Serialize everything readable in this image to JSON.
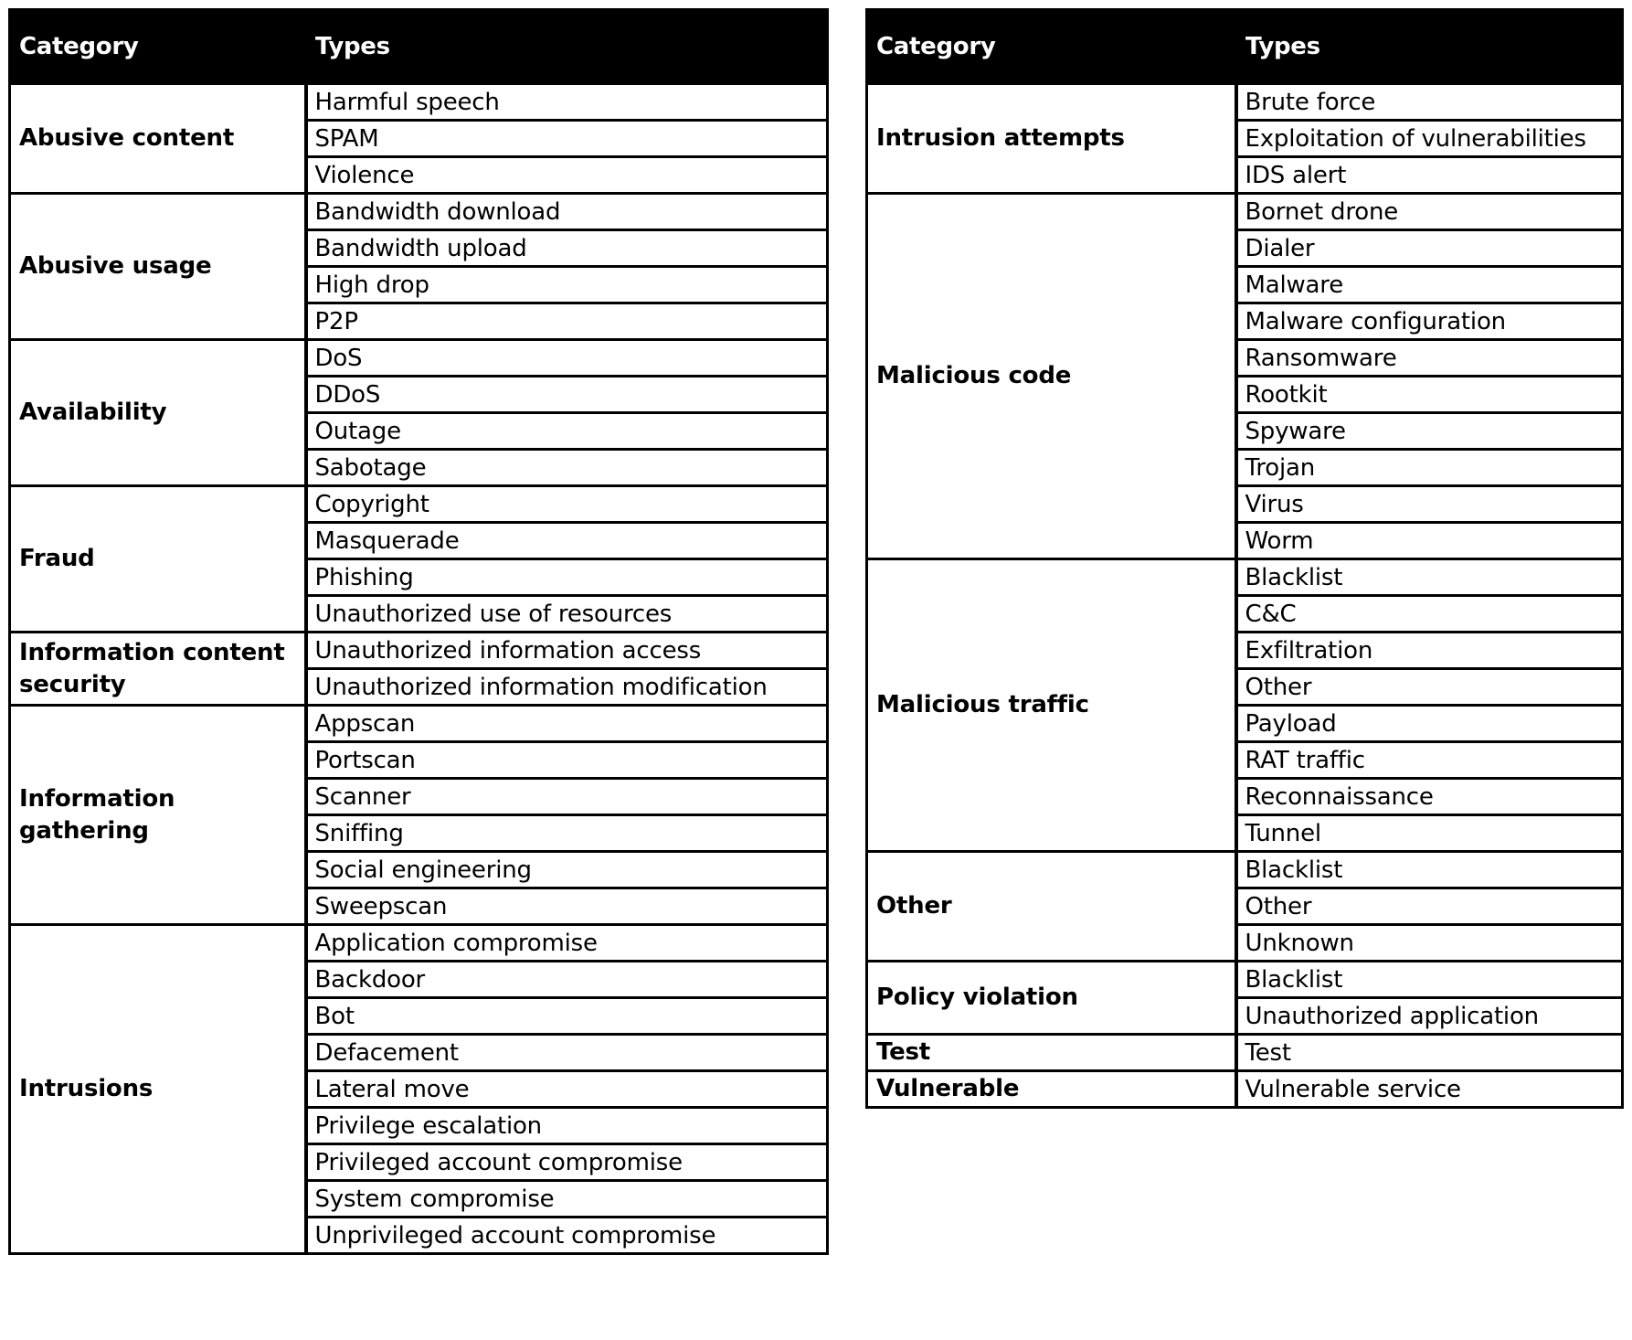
{
  "tables": [
    {
      "headers": {
        "category": "Category",
        "types": "Types"
      },
      "groups": [
        {
          "category": "Abusive content",
          "types": [
            "Harmful speech",
            "SPAM",
            "Violence"
          ]
        },
        {
          "category": "Abusive usage",
          "types": [
            "Bandwidth download",
            "Bandwidth upload",
            "High drop",
            "P2P"
          ]
        },
        {
          "category": "Availability",
          "types": [
            "DoS",
            "DDoS",
            "Outage",
            "Sabotage"
          ]
        },
        {
          "category": "Fraud",
          "types": [
            "Copyright",
            "Masquerade",
            "Phishing",
            "Unauthorized use of resources"
          ]
        },
        {
          "category": "Information content security",
          "types": [
            "Unauthorized information access",
            "Unauthorized information modification"
          ]
        },
        {
          "category": "Information gathering",
          "types": [
            "Appscan",
            "Portscan",
            "Scanner",
            "Sniffing",
            "Social engineering",
            "Sweepscan"
          ]
        },
        {
          "category": "Intrusions",
          "types": [
            "Application compromise",
            "Backdoor",
            "Bot",
            "Defacement",
            "Lateral move",
            "Privilege escalation",
            "Privileged account compromise",
            "System compromise",
            "Unprivileged account compromise"
          ]
        }
      ]
    },
    {
      "headers": {
        "category": "Category",
        "types": "Types"
      },
      "groups": [
        {
          "category": "Intrusion attempts",
          "types": [
            "Brute force",
            "Exploitation of vulnerabilities",
            "IDS alert"
          ]
        },
        {
          "category": "Malicious code",
          "types": [
            "Bornet drone",
            "Dialer",
            "Malware",
            "Malware configuration",
            "Ransomware",
            "Rootkit",
            "Spyware",
            "Trojan",
            "Virus",
            "Worm"
          ]
        },
        {
          "category": "Malicious traffic",
          "types": [
            "Blacklist",
            "C&C",
            "Exfiltration",
            "Other",
            "Payload",
            "RAT traffic",
            "Reconnaissance",
            "Tunnel"
          ]
        },
        {
          "category": "Other",
          "types": [
            "Blacklist",
            "Other",
            "Unknown"
          ]
        },
        {
          "category": "Policy violation",
          "types": [
            "Blacklist",
            "Unauthorized application"
          ]
        },
        {
          "category": "Test",
          "types": [
            "Test"
          ]
        },
        {
          "category": "Vulnerable",
          "types": [
            "Vulnerable service"
          ]
        }
      ]
    }
  ],
  "colors": {
    "header_bg": "#000000",
    "header_text": "#ffffff",
    "border": "#000000",
    "cell_bg": "#ffffff"
  }
}
